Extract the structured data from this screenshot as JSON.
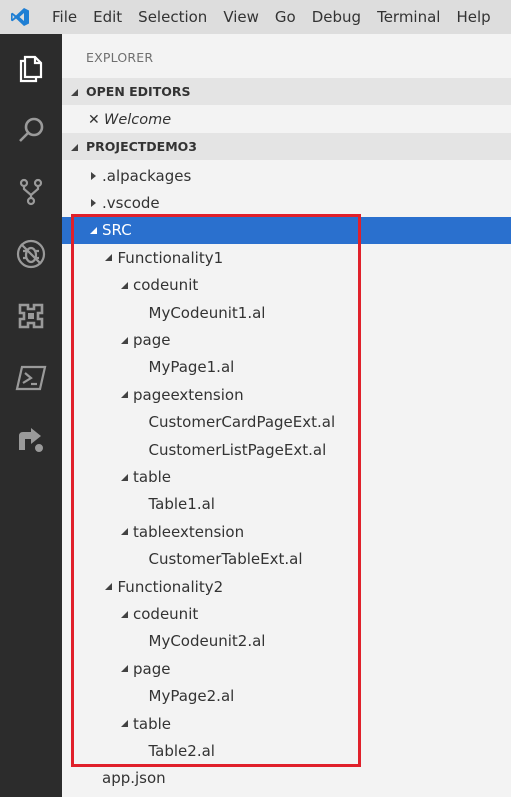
{
  "menu": [
    "File",
    "Edit",
    "Selection",
    "View",
    "Go",
    "Debug",
    "Terminal",
    "Help"
  ],
  "activity": [
    "files-icon",
    "search-icon",
    "source-control-icon",
    "debug-icon",
    "extensions-icon",
    "powershell-icon",
    "remote-icon"
  ],
  "explorer": {
    "title": "EXPLORER",
    "open_editors": {
      "header": "OPEN EDITORS",
      "items": [
        {
          "name": "Welcome"
        }
      ]
    },
    "project": {
      "header": "PROJECTDEMO3",
      "items": [
        {
          "label": ".alpackages",
          "depth": 0,
          "kind": "folder",
          "expanded": false
        },
        {
          "label": ".vscode",
          "depth": 0,
          "kind": "folder",
          "expanded": false
        },
        {
          "label": "SRC",
          "depth": 0,
          "kind": "folder",
          "expanded": true,
          "selected": true
        },
        {
          "label": "Functionality1",
          "depth": 1,
          "kind": "folder",
          "expanded": true
        },
        {
          "label": "codeunit",
          "depth": 2,
          "kind": "folder",
          "expanded": true
        },
        {
          "label": "MyCodeunit1.al",
          "depth": 3,
          "kind": "file"
        },
        {
          "label": "page",
          "depth": 2,
          "kind": "folder",
          "expanded": true
        },
        {
          "label": "MyPage1.al",
          "depth": 3,
          "kind": "file"
        },
        {
          "label": "pageextension",
          "depth": 2,
          "kind": "folder",
          "expanded": true
        },
        {
          "label": "CustomerCardPageExt.al",
          "depth": 3,
          "kind": "file"
        },
        {
          "label": "CustomerListPageExt.al",
          "depth": 3,
          "kind": "file"
        },
        {
          "label": "table",
          "depth": 2,
          "kind": "folder",
          "expanded": true
        },
        {
          "label": "Table1.al",
          "depth": 3,
          "kind": "file"
        },
        {
          "label": "tableextension",
          "depth": 2,
          "kind": "folder",
          "expanded": true
        },
        {
          "label": "CustomerTableExt.al",
          "depth": 3,
          "kind": "file"
        },
        {
          "label": "Functionality2",
          "depth": 1,
          "kind": "folder",
          "expanded": true
        },
        {
          "label": "codeunit",
          "depth": 2,
          "kind": "folder",
          "expanded": true
        },
        {
          "label": "MyCodeunit2.al",
          "depth": 3,
          "kind": "file"
        },
        {
          "label": "page",
          "depth": 2,
          "kind": "folder",
          "expanded": true
        },
        {
          "label": "MyPage2.al",
          "depth": 3,
          "kind": "file"
        },
        {
          "label": "table",
          "depth": 2,
          "kind": "folder",
          "expanded": true
        },
        {
          "label": "Table2.al",
          "depth": 3,
          "kind": "file"
        },
        {
          "label": "app.json",
          "depth": 0,
          "kind": "file"
        }
      ]
    }
  },
  "colors": {
    "accent": "#2a70ce",
    "highlight": "#e0202a",
    "activity_bg": "#2c2c2c"
  }
}
